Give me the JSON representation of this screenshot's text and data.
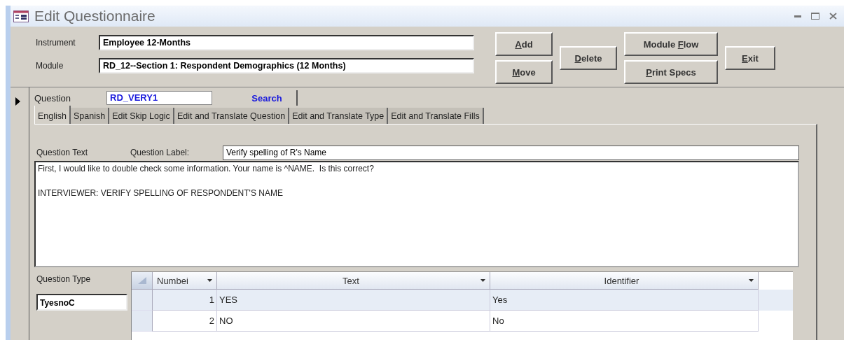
{
  "window": {
    "title": "Edit Questionnaire"
  },
  "header_fields": [
    {
      "label": "Instrument",
      "value": "Employee 12-Months"
    },
    {
      "label": "Module",
      "value": "RD_12--Section 1: Respondent Demographics (12 Months)"
    }
  ],
  "button_groups": [
    [
      {
        "access_key": "A",
        "rest": "dd"
      },
      {
        "access_key": "M",
        "rest": "ove"
      }
    ],
    [
      {
        "access_key": "D",
        "rest": "elete"
      }
    ],
    [
      {
        "before": "Module ",
        "access_key": "F",
        "rest": "low"
      },
      {
        "access_key": "P",
        "rest": "rint Specs"
      }
    ],
    [
      {
        "access_key": "E",
        "rest": "xit"
      }
    ]
  ],
  "question": {
    "label": "Question",
    "value": "RD_VERY1",
    "search_button": "Search"
  },
  "tabs": [
    {
      "label": "English",
      "selected": true
    },
    {
      "label": "Spanish",
      "selected": false
    },
    {
      "label": "Edit Skip Logic",
      "selected": false
    },
    {
      "label": "Edit and Translate Question",
      "selected": false
    },
    {
      "label": "Edit and Translate Type",
      "selected": false
    },
    {
      "label": "Edit and Translate Fills",
      "selected": false
    }
  ],
  "question_text": {
    "label": "Question Text",
    "question_label_caption": "Question Label:",
    "question_label_value": "Verify spelling of R's Name",
    "paragraphs": [
      "First, I would like to double check some information. Your name is ^NAME.  Is this correct?",
      "INTERVIEWER: VERIFY SPELLING OF RESPONDENT'S NAME"
    ]
  },
  "question_type": {
    "label": "Question Type",
    "value": "TyesnoC"
  },
  "table": {
    "columns": [
      "Numbei",
      "Text",
      "Identifier"
    ],
    "rows": [
      {
        "number": "1",
        "text": "YES",
        "identifier": "Yes",
        "selected": true
      },
      {
        "number": "2",
        "text": "NO",
        "identifier": "No",
        "selected": false
      }
    ]
  }
}
